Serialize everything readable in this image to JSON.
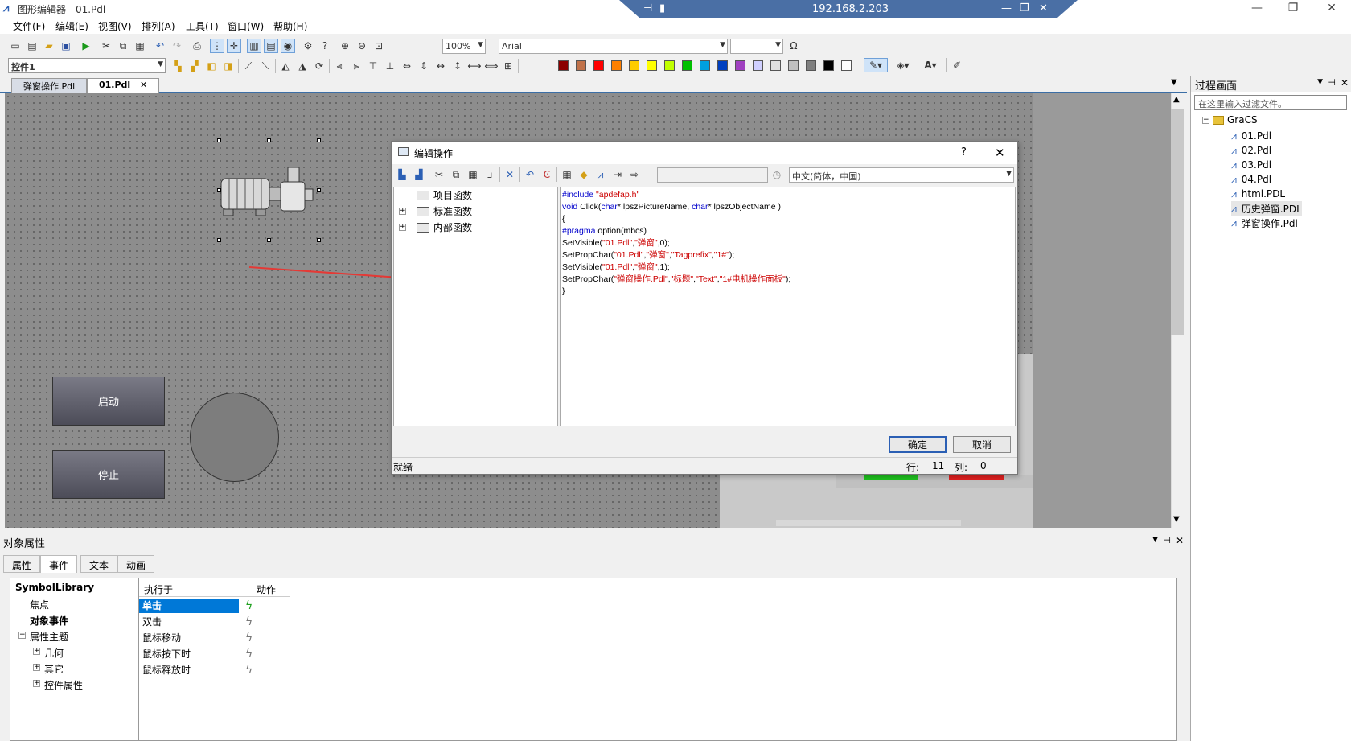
{
  "title_bar": {
    "app_title": "图形编辑器 - 01.Pdl",
    "remote_ip": "192.168.2.203"
  },
  "menu": [
    "文件(F)",
    "编辑(E)",
    "视图(V)",
    "排列(A)",
    "工具(T)",
    "窗口(W)",
    "帮助(H)"
  ],
  "toolbar": {
    "zoom": "100%",
    "font": "Arial",
    "omega": "Ω",
    "control_combo": "控件1"
  },
  "palette": [
    "#8b0000",
    "#c0724a",
    "#ff0000",
    "#ff8000",
    "#ffcc00",
    "#ffff00",
    "#c0ff00",
    "#00c000",
    "#00a0e0",
    "#0040c0",
    "#a040c0",
    "#d0d0ff",
    "#e0e0e0",
    "#c0c0c0",
    "#808080",
    "#000000",
    "#ffffff"
  ],
  "doc_tabs": [
    {
      "label": "弹窗操作.Pdl"
    },
    {
      "label": "01.Pdl",
      "close": "✕"
    }
  ],
  "canvas": {
    "start_button": "启动",
    "stop_button": "停止"
  },
  "right_panel": {
    "title": "过程画面",
    "filter_placeholder": "在这里输入过滤文件。",
    "root": "GraCS",
    "files": [
      "01.Pdl",
      "02.Pdl",
      "03.Pdl",
      "04.Pdl",
      "html.PDL",
      "历史弹窗.PDL",
      "弹窗操作.Pdl"
    ]
  },
  "dialog": {
    "title": "编辑操作",
    "help": "?",
    "close": "✕",
    "language": "中文(简体，中国)",
    "tree": [
      "项目函数",
      "标准函数",
      "内部函数"
    ],
    "code": [
      {
        "parts": [
          {
            "t": "#include ",
            "c": "kw"
          },
          {
            "t": "\"apdefap.h\"",
            "c": "str"
          }
        ]
      },
      {
        "parts": [
          {
            "t": "void ",
            "c": "kw"
          },
          {
            "t": "Click(",
            "c": ""
          },
          {
            "t": "char",
            "c": "kw"
          },
          {
            "t": "* lpszPictureName, ",
            "c": ""
          },
          {
            "t": "char",
            "c": "kw"
          },
          {
            "t": "* lpszObjectName )",
            "c": ""
          }
        ]
      },
      {
        "parts": [
          {
            "t": "{",
            "c": ""
          }
        ]
      },
      {
        "parts": [
          {
            "t": "#pragma ",
            "c": "kw"
          },
          {
            "t": "option(mbcs)",
            "c": ""
          }
        ]
      },
      {
        "parts": [
          {
            "t": "SetVisible(",
            "c": ""
          },
          {
            "t": "\"01.Pdl\"",
            "c": "str"
          },
          {
            "t": ",",
            "c": ""
          },
          {
            "t": "\"弹窗\"",
            "c": "str"
          },
          {
            "t": ",0);",
            "c": ""
          }
        ]
      },
      {
        "parts": [
          {
            "t": "SetPropChar(",
            "c": ""
          },
          {
            "t": "\"01.Pdl\"",
            "c": "str"
          },
          {
            "t": ",",
            "c": ""
          },
          {
            "t": "\"弹窗\"",
            "c": "str"
          },
          {
            "t": ",",
            "c": ""
          },
          {
            "t": "\"Tagprefix\"",
            "c": "str"
          },
          {
            "t": ",",
            "c": ""
          },
          {
            "t": "\"1#\"",
            "c": "str"
          },
          {
            "t": ");",
            "c": ""
          }
        ]
      },
      {
        "parts": [
          {
            "t": "SetVisible(",
            "c": ""
          },
          {
            "t": "\"01.Pdl\"",
            "c": "str"
          },
          {
            "t": ",",
            "c": ""
          },
          {
            "t": "\"弹窗\"",
            "c": "str"
          },
          {
            "t": ",1);",
            "c": ""
          }
        ]
      },
      {
        "parts": [
          {
            "t": "SetPropChar(",
            "c": ""
          },
          {
            "t": "\"弹窗操作.Pdl\"",
            "c": "str"
          },
          {
            "t": ",",
            "c": ""
          },
          {
            "t": "\"标题\"",
            "c": "str"
          },
          {
            "t": ",",
            "c": ""
          },
          {
            "t": "\"Text\"",
            "c": "str"
          },
          {
            "t": ",",
            "c": ""
          },
          {
            "t": "\"1#电机操作面板\"",
            "c": "str"
          },
          {
            "t": ");",
            "c": ""
          }
        ]
      },
      {
        "parts": [
          {
            "t": "}",
            "c": ""
          }
        ]
      }
    ],
    "ok": "确定",
    "cancel": "取消",
    "status": "就绪",
    "row_label": "行:",
    "row_value": "11",
    "col_label": "列:",
    "col_value": "0"
  },
  "properties": {
    "title": "对象属性",
    "tabs": [
      "属性",
      "事件",
      "文本",
      "动画"
    ],
    "active_tab": "事件",
    "tree": {
      "root": "SymbolLibrary",
      "items": [
        "焦点",
        "对象事件",
        "属性主题",
        "几何",
        "其它",
        "控件属性"
      ]
    },
    "columns": [
      "执行于",
      "动作"
    ],
    "events": [
      "单击",
      "双击",
      "鼠标移动",
      "鼠标按下时",
      "鼠标释放时"
    ],
    "selected_event": "单击"
  },
  "colors": {
    "accent": "#0078d7",
    "selection": "#0078d7",
    "arrow": "#e53935"
  }
}
